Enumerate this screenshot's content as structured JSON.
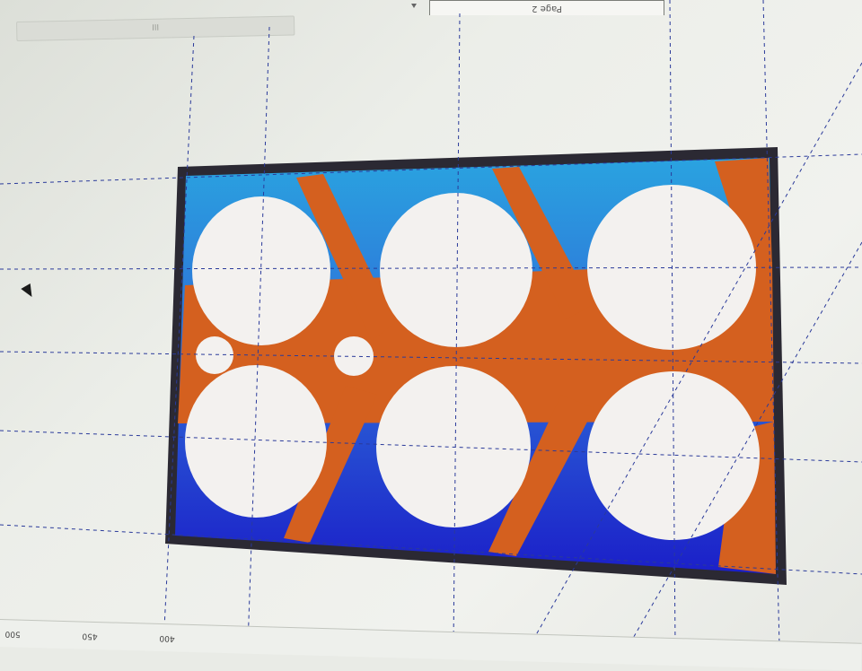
{
  "toolbar": {
    "scroll_thumb_label": "III",
    "page_tab_label": "Page 2"
  },
  "ruler": {
    "labels": [
      "500",
      "450",
      "400"
    ]
  },
  "artwork": {
    "colors": {
      "orange": "#d4601f",
      "blue_top": "#2aa3e0",
      "blue_bottom": "#1b1fc9",
      "frame": "#2b2933",
      "hole": "#f3f1ef"
    }
  }
}
